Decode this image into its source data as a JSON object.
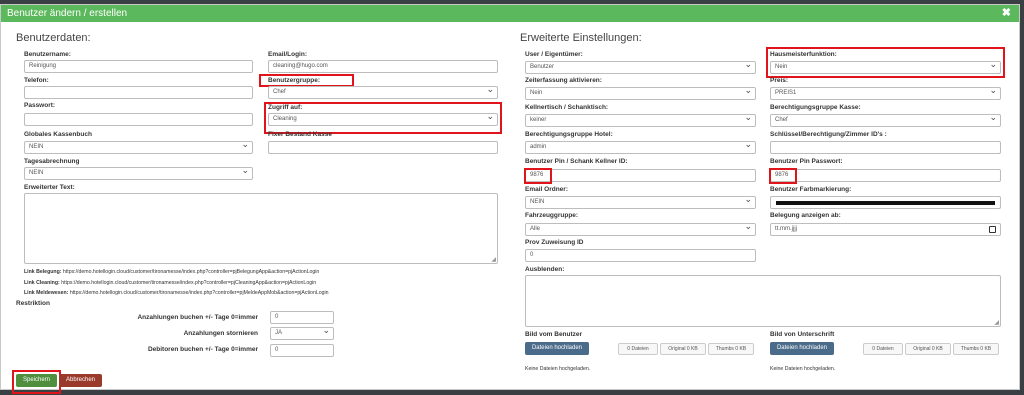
{
  "title": "Benutzer ändern / erstellen",
  "close_symbol": "✖",
  "left": {
    "section_title": "Benutzerdaten:",
    "benutzername_label": "Benutzername:",
    "benutzername_value": "Reinigung",
    "email_label": "Email/Login:",
    "email_value": "cleaning@hugo.com",
    "telefon_label": "Telefon:",
    "benutzergruppe_label": "Benutzergruppe:",
    "benutzergruppe_value": "Chef",
    "passwort_label": "Passwort:",
    "zugriff_label": "Zugriff auf:",
    "zugriff_value": "Cleaning",
    "globales_label": "Globales Kassenbuch",
    "globales_value": "NEIN",
    "fixer_label": "Fixer Bestand Kasse",
    "tagesabrechnung_label": "Tagesabrechnung",
    "tagesabrechnung_value": "NEIN",
    "erweiterter_label": "Erweiterter Text:",
    "links": [
      {
        "name": "Link Belegung:",
        "url": "https://demo.hotellogin.cloud/customer/tironamesse/index.php?controller=pjBelegungApp&action=pjActionLogin"
      },
      {
        "name": "Link Cleaning:",
        "url": "https://demo.hotellogin.cloud/customer/tironamesse/index.php?controller=pjCleaningApp&action=pjActionLogin"
      },
      {
        "name": "Link Meldewesen:",
        "url": "https://demo.hotellogin.cloud/customer/tironamesse/index.php?controller=pjMeldeAppMob&action=pjActionLogin"
      }
    ],
    "restriktion_label": "Restriktion",
    "anzahlungen_buchen_label": "Anzahlungen buchen +/- Tage 0=immer",
    "anzahlungen_buchen_value": "0",
    "anzahlungen_stornieren_label": "Anzahlungen stornieren",
    "anzahlungen_stornieren_value": "JA",
    "debitoren_label": "Debitoren buchen +/- Tage 0=immer",
    "debitoren_value": "0",
    "save_label": "Speichern",
    "cancel_label": "Abbrechen"
  },
  "right": {
    "section_title": "Erweiterte Einstellungen:",
    "user_label": "User / Eigentümer:",
    "user_value": "Benutzer",
    "hausmeister_label": "Hausmeisterfunktion:",
    "hausmeister_value": "Nein",
    "zeiterfassung_label": "Zeiterfassung aktivieren:",
    "zeiterfassung_value": "Nein",
    "preis_label": "Preis:",
    "preis_value": "PREIS1",
    "kellnertisch_label": "Kellnertisch / Schanktisch:",
    "kellnertisch_value": "keiner",
    "berechtigung_kasse_label": "Berechtigungsgruppe Kasse:",
    "berechtigung_kasse_value": "Chef",
    "berechtigung_hotel_label": "Berechtigungsgruppe Hotel:",
    "berechtigung_hotel_value": "admin",
    "schluessel_label": "Schlüssel/Berechtigung/Zimmer ID's :",
    "pin_label": "Benutzer Pin / Schank Kellner ID:",
    "pin_value": "9876",
    "pin_passwort_label": "Benutzer Pin Passwort:",
    "pin_passwort_value": "9876",
    "email_ordner_label": "Email Ordner:",
    "email_ordner_value": "NEIN",
    "farbmarkierung_label": "Benutzer Farbmarkierung:",
    "farbe": "#111111",
    "fahrzeuggruppe_label": "Fahrzeuggruppe:",
    "fahrzeuggruppe_value": "Alle",
    "belegung_label": "Belegung anzeigen ab:",
    "belegung_value": "tt.mm.jjjj",
    "prov_label": "Prov Zuweisung ID",
    "prov_value": "0",
    "ausblenden_label": "Ausblenden:",
    "bild_benutzer_label": "Bild vom Benutzer",
    "bild_unterschrift_label": "Bild von Unterschrift",
    "upload_label": "Dateien hochladen",
    "stat_dateien": "0 Dateien",
    "stat_original": "Original 0 KB",
    "stat_thumbs": "Thumbs 0 KB",
    "keine_dateien": "Keine Dateien hochgeladen."
  },
  "accent_colors": {
    "titlebar": "#5cb85c",
    "highlight": "#e0151b",
    "save": "#4f8f3e",
    "cancel": "#9a3a2b",
    "upload": "#4b6b8a"
  }
}
